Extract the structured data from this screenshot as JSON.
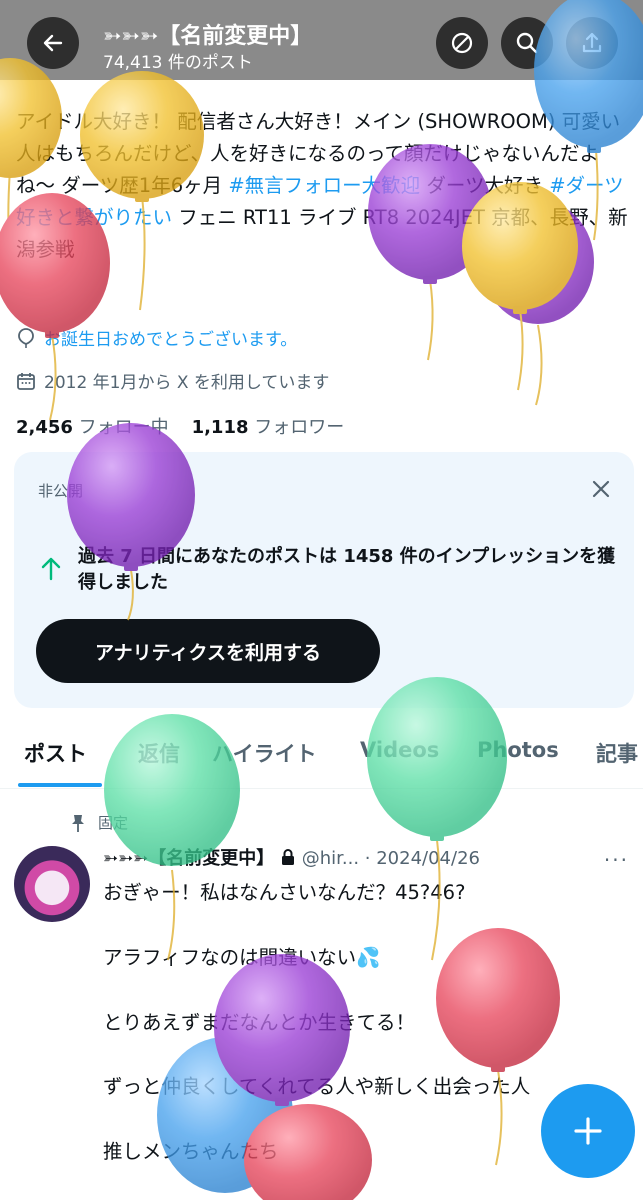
{
  "header": {
    "title": "➳➳➳【名前変更中】",
    "post_count": "74,413 件のポスト"
  },
  "bio": {
    "text_1": "アイドル大好き！ 配信者さん大好き！メイン (SHOWROOM) 可愛い人はもちろんだけど、人を好きになるのって顔だけじゃないんだよね〜 ダーツ歴1年6ヶ月 ",
    "hashtag_1": "#無言フォロー大歓迎",
    "text_2": " ダーツ大好き ",
    "hashtag_2": "#ダーツ好きと繋がりたい",
    "text_3": " フェニ RT11 ライブ RT8 2024JET 京都、長野、新潟参戦"
  },
  "meta": {
    "birthday": "お誕生日おめでとうございます。",
    "joined": "2012 年1月から X を利用しています"
  },
  "stats": {
    "following_count": "2,456",
    "following_label": "フォロー中",
    "followers_count": "1,118",
    "followers_label": "フォロワー"
  },
  "analytics_card": {
    "label": "非公開",
    "message": "過去 7 日間にあなたのポストは 1458 件のインプレッションを獲得しました",
    "button": "アナリティクスを利用する"
  },
  "tabs": [
    "ポスト",
    "返信",
    "ハイライト",
    "Videos",
    "Photos",
    "記事"
  ],
  "post": {
    "pinned_label": "固定",
    "author": "➳➳➳【名前変更中】",
    "handle": "@hir...",
    "date": "· 2024/04/26",
    "lines": [
      "おぎゃー！私はなんさいなんだ？45?46?",
      "アラフィフなのは間違いない💦",
      "とりあえずまだなんとか生きてる！",
      "ずっと仲良くしてくれてる人や新しく出会った人",
      "推しメンちゃんたち"
    ]
  },
  "colors": {
    "accent": "#1d9bf0",
    "balloon_yellow": "#f2c230",
    "balloon_red": "#e8485e",
    "balloon_purple": "#9b3fd6",
    "balloon_green": "#5fe0a8",
    "balloon_blue": "#4aa3ee"
  }
}
